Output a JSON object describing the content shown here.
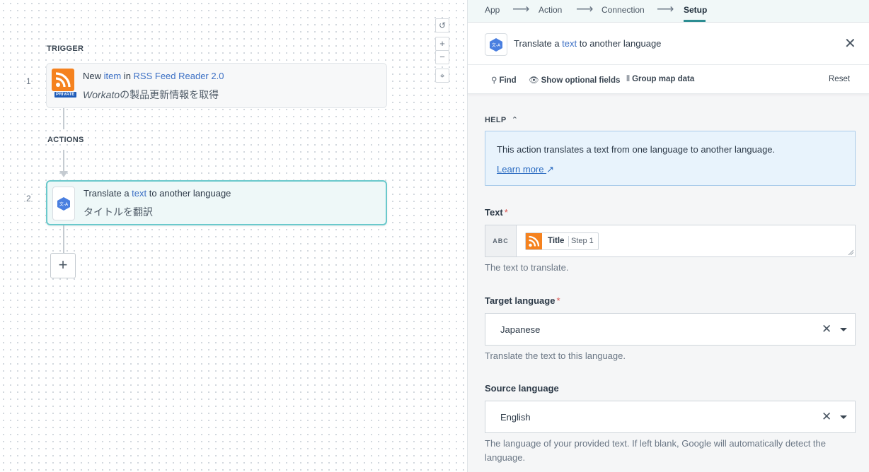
{
  "canvas": {
    "trigger_label": "TRIGGER",
    "actions_label": "ACTIONS",
    "steps": [
      {
        "number": "1",
        "title_pre": "New ",
        "title_link1": "item",
        "title_mid": " in ",
        "title_link2": "RSS Feed Reader 2.0",
        "sub_italic": "Workato",
        "sub_rest": "の製品更新情報を取得",
        "badge": "PRIVATE",
        "icon": "rss-icon"
      },
      {
        "number": "2",
        "title_pre": "Translate a ",
        "title_link1": "text",
        "title_post": " to another language",
        "sub": "タイトルを翻訳",
        "icon": "google-translate-icon"
      }
    ],
    "add_button": "+",
    "controls": {
      "reset": "↺",
      "zoom_in": "+",
      "zoom_out": "−",
      "fit": "⌖"
    }
  },
  "wizard": {
    "steps": [
      "App",
      "Action",
      "Connection",
      "Setup"
    ],
    "current": "Setup",
    "arrow": "⟶"
  },
  "panel": {
    "title_pre": "Translate a ",
    "title_link": "text",
    "title_post": " to another language",
    "close": "✕",
    "toolbar": {
      "find": "Find",
      "optional": "Show optional fields",
      "group": "Group map data",
      "reset": "Reset"
    },
    "help": {
      "heading": "HELP",
      "text": "This action translates a text from one language to another language.",
      "link": "Learn more"
    },
    "fields": {
      "text": {
        "label": "Text",
        "required": "*",
        "prefix": "ABC",
        "pill_title": "Title",
        "pill_step": "Step 1",
        "hint": "The text to translate."
      },
      "target": {
        "label": "Target language",
        "required": "*",
        "value": "Japanese",
        "hint": "Translate the text to this language."
      },
      "source": {
        "label": "Source language",
        "value": "English",
        "hint1": "The language of your provided text. If left blank, Google will automatically detect the",
        "hint2": "language."
      }
    }
  },
  "colors": {
    "accent": "#2c8d92",
    "link": "#3b6fc4",
    "rss": "#f5821f",
    "active_border": "#6ac9cc",
    "required": "#d9534f"
  }
}
